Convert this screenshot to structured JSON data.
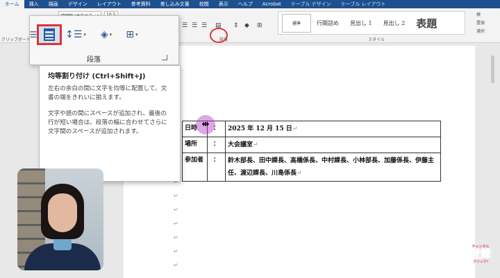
{
  "ribbon_tabs": [
    "ホーム",
    "挿入",
    "描画",
    "デザイン",
    "レイアウト",
    "参考資料",
    "差し込み文書",
    "校閲",
    "表示",
    "ヘルプ",
    "Acrobat",
    "テーブル デザイン",
    "テーブル レイアウト"
  ],
  "ribbon": {
    "font_name": "游明朝 (本文のフォン",
    "font_size": "10.5",
    "clipboard_label": "クリップボード",
    "paragraph_label": "段落",
    "style_label": "スタイル",
    "find_label": "検",
    "replace_label": "置換",
    "select_label": "選択",
    "styles": [
      "標準",
      "行間詰め",
      "見出し 1",
      "見出し 2",
      "表題"
    ]
  },
  "popup": {
    "title": "段落"
  },
  "tooltip": {
    "title": "均等割り付け (Ctrl+Shift+J)",
    "paragraph1": "左右の余白の間に文字を均等に配置して、文書の端をきれいに揃えます。",
    "paragraph2": "文字や語の間にスペースが追加され、最後の行が短い場合は、段落の幅に合わせてさらに文字間のスペースが追加されます。"
  },
  "table": {
    "rows": [
      {
        "label": "日時",
        "colon": "：",
        "value": "2025 年 12 月 15 日"
      },
      {
        "label": "場所",
        "colon": "：",
        "value": "大会議室"
      },
      {
        "label": "参加者",
        "colon": "：",
        "value": "鈴木部長、田中課長、高橋係長、中村課長、小林部長、加藤係長、伊藤主任、渡辺課長、川島係長"
      }
    ]
  },
  "paragraph_mark": "↵",
  "subscribe": {
    "small_top": "チャンネル",
    "big": "登録",
    "small_bottom": "クリック!"
  },
  "colors": {
    "ribbon_blue": "#1e4f8f",
    "highlight_red": "#dd3333",
    "cursor_purple": "#b43cc8"
  }
}
